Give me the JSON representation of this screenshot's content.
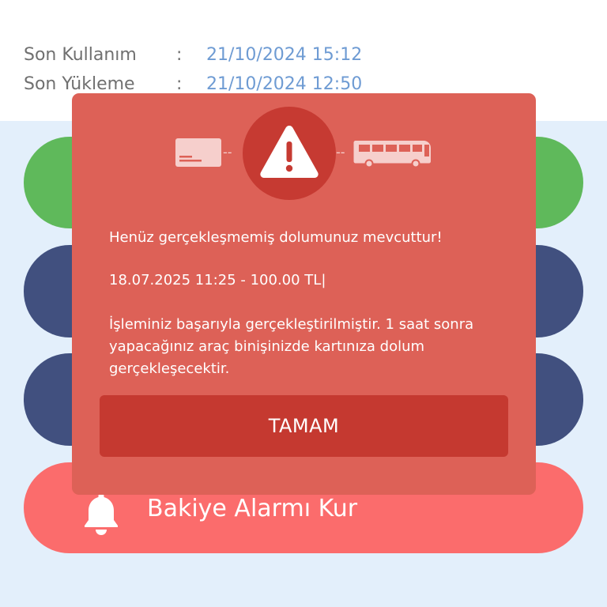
{
  "info": {
    "last_use_label": "Son Kullanım",
    "last_use_colon": ":",
    "last_use_value": "21/10/2024 15:12",
    "last_load_label": "Son Yükleme",
    "last_load_colon": ":",
    "last_load_value": "21/10/2024 12:50"
  },
  "alarm": {
    "label": "Bakiye Alarmı Kur",
    "icon": "bell-icon"
  },
  "dialog": {
    "icons": [
      "card-icon",
      "warning-icon",
      "bus-icon"
    ],
    "dash_left": "--",
    "dash_right": "--",
    "message_title": "Henüz gerçekleşmemiş dolumunuz mevcuttur!",
    "pending_load": "18.07.2025 11:25 - 100.00 TL|",
    "message_body": "İşleminiz başarıyla gerçekleştirilmiştir. 1 saat sonra yapacağınız araç binişinizde kartınıza dolum gerçekleşecektir.",
    "ok_label": "TAMAM"
  },
  "colors": {
    "dialog_bg": "#dd6157",
    "dialog_button": "#c53930",
    "alarm_pill": "#fb6c6c",
    "green_pill": "#5fb95b",
    "navy_pill": "#41507f",
    "value_blue": "#6e9bd3"
  }
}
